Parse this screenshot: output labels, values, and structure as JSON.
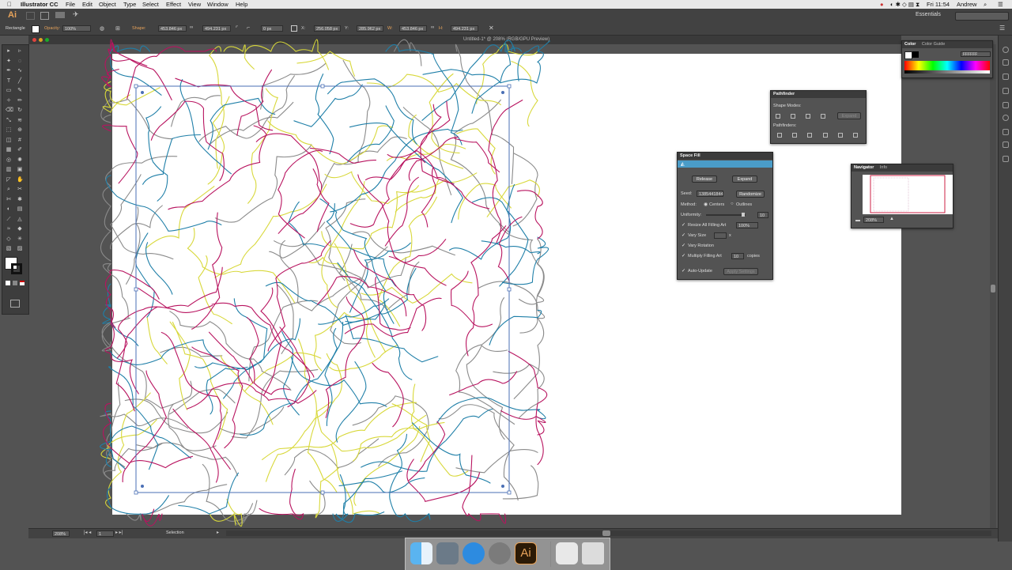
{
  "menubar": {
    "app_name": "Illustrator CC",
    "menus": [
      "File",
      "Edit",
      "Object",
      "Type",
      "Select",
      "Effect",
      "View",
      "Window",
      "Help"
    ],
    "clock": "Fri 11:54",
    "user": "Andrew"
  },
  "appbar": {
    "logo": "Ai",
    "workspace": "Essentials"
  },
  "control_bar": {
    "selection_type": "Rectangle",
    "opacity_label": "Opacity:",
    "opacity_value": "100%",
    "shape_label": "Shape:",
    "shape_w": "453.846 px",
    "shape_h": "494.231 px",
    "corner": "0 px",
    "x_label": "X:",
    "x_value": "256.058 px",
    "y_label": "Y:",
    "y_value": "285.962 px",
    "w_label": "W:",
    "w_value": "453.846 px",
    "h_label": "H:",
    "h_value": "494.231 px"
  },
  "document": {
    "title": "Untitled-1* @ 208% (RGB/GPU Preview)"
  },
  "color_panel": {
    "tabs": [
      "Color",
      "Color Guide"
    ],
    "hex": "FFFFFF"
  },
  "pathfinder": {
    "title": "Pathfinder",
    "shape_modes_label": "Shape Modes:",
    "pathfinders_label": "Pathfinders:",
    "expand_label": "Expand"
  },
  "space_fill": {
    "title": "Space Fill",
    "release_label": "Release",
    "expand_label": "Expand",
    "seed_label": "Seed:",
    "seed_value": "1385441844",
    "randomize_label": "Randomize",
    "method_label": "Method:",
    "method_centers": "Centers",
    "method_outlines": "Outlines",
    "uniformity_label": "Uniformity:",
    "uniformity_value": "10",
    "resize_label": "Resize All Filling Art",
    "resize_value": "100%",
    "vary_size_label": "Vary Size",
    "vary_size_suffix": "x",
    "vary_rotation_label": "Vary Rotation",
    "multiply_label": "Multiply Filling Art",
    "multiply_value": "10",
    "multiply_suffix": "copies",
    "auto_update_label": "Auto-Update",
    "apply_label": "Apply Settings"
  },
  "navigator": {
    "tabs": [
      "Navigator",
      "Info"
    ],
    "zoom": "208%"
  },
  "status_bar": {
    "zoom": "208%",
    "page": "1",
    "tool": "Selection"
  },
  "colors": {
    "magenta": "#b8135f",
    "teal": "#1f7fa8",
    "yellow": "#d8d83a",
    "gray": "#8a8a8a",
    "selection": "#4a6fb5"
  }
}
